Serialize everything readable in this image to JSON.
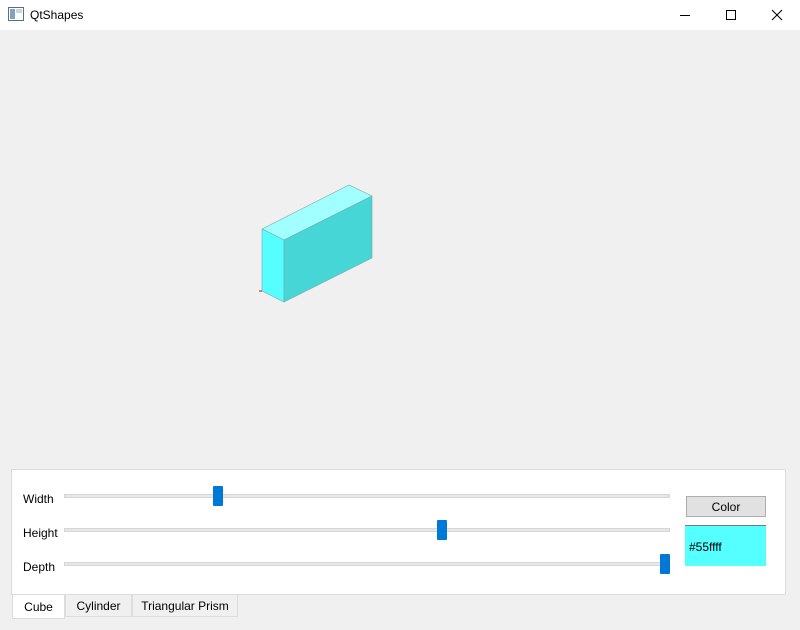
{
  "window": {
    "title": "QtShapes",
    "icons": {
      "app": "qt-app-icon",
      "minimize": "minimize-icon",
      "maximize": "maximize-icon",
      "close": "close-icon"
    }
  },
  "shape": {
    "type": "cube",
    "color": "#55ffff"
  },
  "controls": {
    "sliders": [
      {
        "label": "Width",
        "value": 0.25
      },
      {
        "label": "Height",
        "value": 0.625
      },
      {
        "label": "Depth",
        "value": 1.0
      }
    ],
    "color_button_label": "Color",
    "color_value": "#55ffff"
  },
  "tabs": [
    {
      "label": "Cube",
      "active": true
    },
    {
      "label": "Cylinder",
      "active": false
    },
    {
      "label": "Triangular Prism",
      "active": false
    }
  ]
}
